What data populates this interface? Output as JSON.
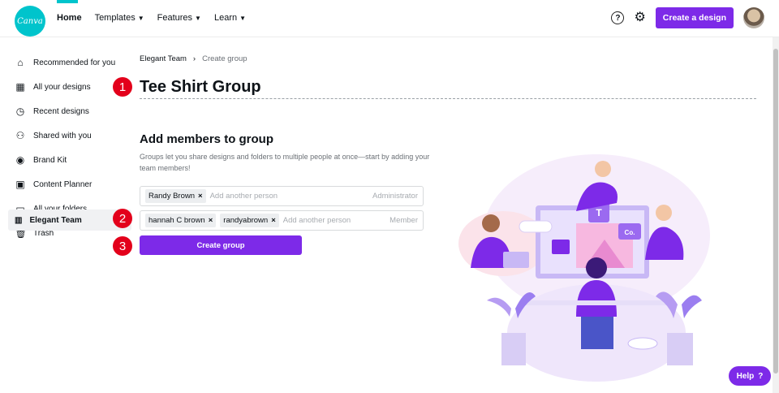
{
  "header": {
    "logo_text": "Canva",
    "nav": [
      {
        "label": "Home"
      },
      {
        "label": "Templates"
      },
      {
        "label": "Features"
      },
      {
        "label": "Learn"
      }
    ],
    "help_glyph": "?",
    "create_design_label": "Create a design"
  },
  "sidebar": {
    "items": [
      {
        "label": "Recommended for you",
        "icon": "home-icon"
      },
      {
        "label": "All your designs",
        "icon": "grid-icon"
      },
      {
        "label": "Recent designs",
        "icon": "clock-icon"
      },
      {
        "label": "Shared with you",
        "icon": "people-icon"
      },
      {
        "label": "Brand Kit",
        "icon": "brand-kit-icon"
      },
      {
        "label": "Content Planner",
        "icon": "calendar-icon"
      },
      {
        "label": "All your folders",
        "icon": "folder-icon"
      },
      {
        "label": "Trash",
        "icon": "trash-icon"
      }
    ],
    "team": {
      "label": "Elegant Team",
      "icon": "building-icon"
    }
  },
  "breadcrumb": {
    "parent": "Elegant Team",
    "separator": "›",
    "current": "Create group"
  },
  "group_name": "Tee Shirt Group",
  "add_members": {
    "title": "Add members to group",
    "description": "Groups let you share designs and folders to multiple people at once—start by adding your team members!"
  },
  "admin_row": {
    "chips": [
      "Randy Brown"
    ],
    "placeholder": "Add another person",
    "role": "Administrator"
  },
  "member_row": {
    "chips": [
      "hannah C brown",
      "randyabrown"
    ],
    "placeholder": "Add another person",
    "role": "Member"
  },
  "chip_remove": "×",
  "create_group_label": "Create group",
  "markers": [
    "1",
    "2",
    "3"
  ],
  "illustration": {
    "t_tile": "T",
    "co_tile": "Co."
  },
  "help_button": {
    "label": "Help",
    "glyph": "?"
  },
  "colors": {
    "brand": "#00c4cc",
    "accent": "#7d2ae8",
    "marker": "#e3001b"
  }
}
